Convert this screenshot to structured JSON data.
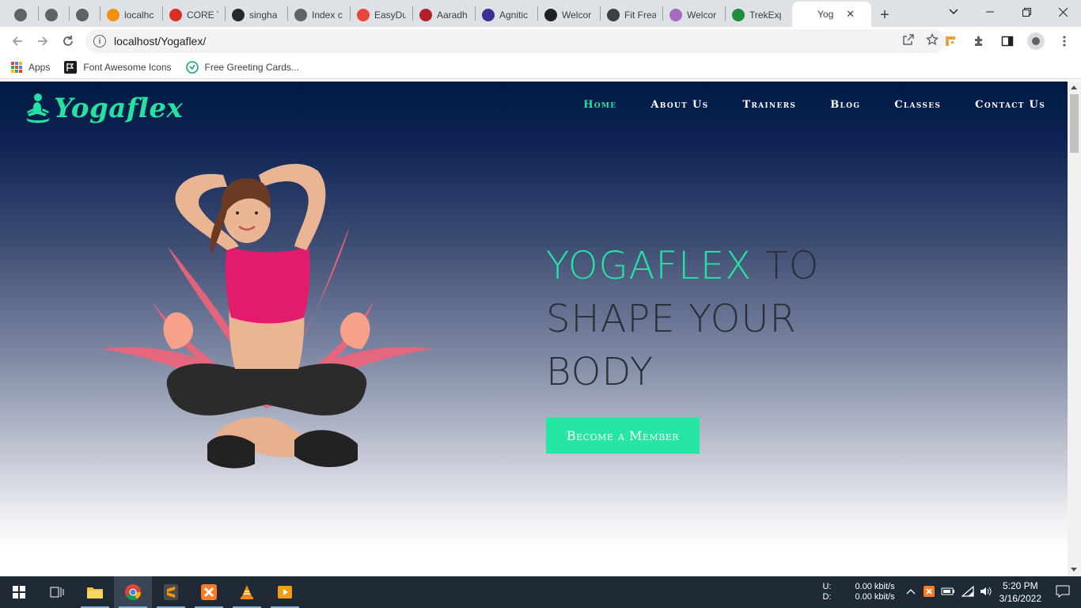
{
  "browser": {
    "tabs": [
      {
        "title": "",
        "icon": "globe-icon",
        "color": "#5f6368"
      },
      {
        "title": "",
        "icon": "globe-icon",
        "color": "#5f6368"
      },
      {
        "title": "",
        "icon": "globe-icon",
        "color": "#5f6368"
      },
      {
        "title": "localhc",
        "icon": "phpmyadmin-icon",
        "color": "#f29111"
      },
      {
        "title": "CORE T",
        "icon": "core-icon",
        "color": "#d93025"
      },
      {
        "title": "singha",
        "icon": "github-icon",
        "color": "#24292e"
      },
      {
        "title": "Index c",
        "icon": "globe-icon",
        "color": "#5f6368"
      },
      {
        "title": "EasyDu",
        "icon": "easydu-icon",
        "color": "#e8453c"
      },
      {
        "title": "Aaradh",
        "icon": "aaradh-icon",
        "color": "#b3202b"
      },
      {
        "title": "Agnitic",
        "icon": "agnitio-icon",
        "color": "#3b2f8f"
      },
      {
        "title": "Welcor",
        "icon": "arch-icon",
        "color": "#202124"
      },
      {
        "title": "Fit Frea",
        "icon": "shield-icon",
        "color": "#3c4043"
      },
      {
        "title": "Welcor",
        "icon": "bootstrap-icon",
        "color": "#a86ac0"
      },
      {
        "title": "TrekExp",
        "icon": "trek-icon",
        "color": "#1e8e3e"
      }
    ],
    "active_tab": {
      "title": "Yog",
      "close": "✕"
    },
    "new_tab": "+",
    "url": "localhost/Yogaflex/",
    "bookmarks": [
      {
        "label": "Apps"
      },
      {
        "label": "Font Awesome Icons"
      },
      {
        "label": "Free Greeting Cards..."
      }
    ]
  },
  "site": {
    "logo": "Yogaflex",
    "nav": [
      {
        "label": "Home",
        "active": true
      },
      {
        "label": "About Us",
        "active": false
      },
      {
        "label": "Trainers",
        "active": false
      },
      {
        "label": "Blog",
        "active": false
      },
      {
        "label": "Classes",
        "active": false
      },
      {
        "label": "Contact Us",
        "active": false
      }
    ],
    "hero": {
      "title_accent": "YOGAFLEX",
      "title_rest": " TO SHAPE YOUR BODY",
      "cta": "Become a Member"
    },
    "colors": {
      "accent": "#25e2a2",
      "nav_bg": "#001a44"
    }
  },
  "taskbar": {
    "net_labels": "U:\nD:",
    "net_values": "0.00 kbit/s\n0.00 kbit/s",
    "time": "5:20 PM",
    "date": "3/16/2022"
  }
}
